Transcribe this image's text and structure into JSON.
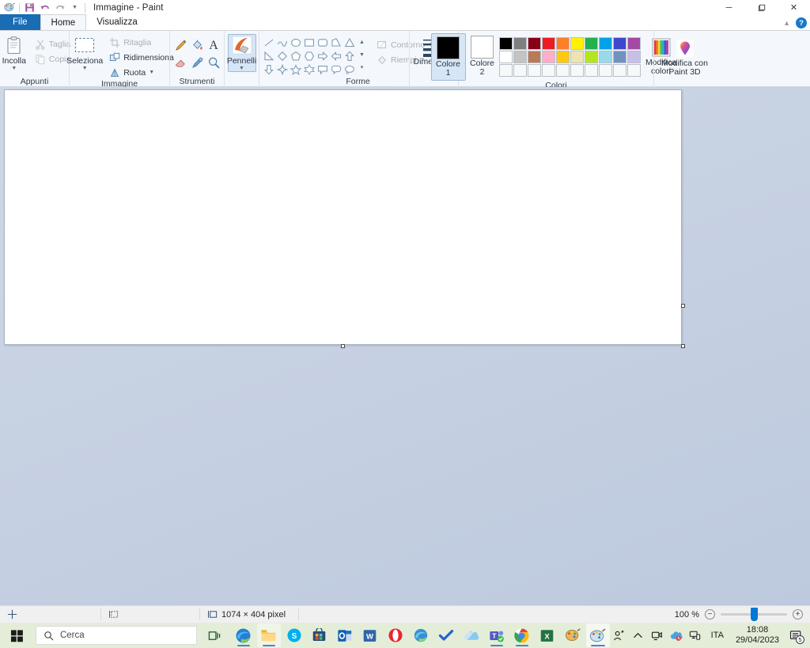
{
  "window": {
    "title": "Immagine - Paint",
    "quick_access": [
      "paint-app-icon",
      "save-icon",
      "undo-icon",
      "redo-icon",
      "customize-caret-icon"
    ],
    "controls": {
      "minimize": "─",
      "maximize": "❐",
      "close": "✕"
    }
  },
  "tabs": {
    "file": "File",
    "items": [
      {
        "label": "Home",
        "active": true
      },
      {
        "label": "Visualizza",
        "active": false
      }
    ],
    "collapse_icon": "chevron-up-icon",
    "help_icon": "help-icon",
    "help_glyph": "?"
  },
  "ribbon": {
    "groups": [
      {
        "name": "clipboard",
        "label": "Appunti",
        "big_button": {
          "label": "Incolla",
          "icon": "paste-icon",
          "has_caret": true
        },
        "small_buttons": [
          {
            "label": "Taglia",
            "icon": "scissors-icon",
            "disabled": true
          },
          {
            "label": "Copia",
            "icon": "copy-icon",
            "disabled": true
          }
        ]
      },
      {
        "name": "image",
        "label": "Immagine",
        "big_button": {
          "label": "Seleziona",
          "icon": "selection-rect-icon",
          "has_caret": true
        },
        "small_buttons": [
          {
            "label": "Ritaglia",
            "icon": "crop-icon",
            "disabled": true
          },
          {
            "label": "Ridimensiona",
            "icon": "resize-icon",
            "disabled": false
          },
          {
            "label": "Ruota",
            "icon": "rotate-icon",
            "disabled": false,
            "has_caret": true
          }
        ]
      },
      {
        "name": "tools",
        "label": "Strumenti",
        "tools": [
          {
            "name": "pencil-icon",
            "title": "Matita"
          },
          {
            "name": "fill-bucket-icon",
            "title": "Riempimento"
          },
          {
            "name": "text-icon",
            "title": "Testo"
          },
          {
            "name": "eraser-icon",
            "title": "Gomma"
          },
          {
            "name": "color-picker-icon",
            "title": "Selezione colore"
          },
          {
            "name": "magnifier-icon",
            "title": "Lente di ingrandimento"
          }
        ]
      },
      {
        "name": "brushes",
        "big_button": {
          "label": "Pennelli",
          "icon": "brush-icon",
          "has_caret": true,
          "selected": true
        }
      },
      {
        "name": "shapes",
        "label": "Forme",
        "shapes": [
          "line",
          "curve",
          "ellipse",
          "rectangle",
          "rounded-rectangle",
          "polygon",
          "triangle",
          "right-triangle",
          "diamond",
          "pentagon",
          "hexagon",
          "arrow-right",
          "arrow-left",
          "arrow-up",
          "arrow-down",
          "four-point-star",
          "five-point-star",
          "six-point-star",
          "callout-rect",
          "callout-round",
          "callout-cloud"
        ],
        "scroll": [
          "scroll-up-icon",
          "scroll-down-icon",
          "more-shapes-icon"
        ],
        "outline": {
          "label": "Contorno",
          "icon": "outline-icon",
          "disabled": true,
          "has_caret": true
        },
        "fill": {
          "label": "Riempi",
          "icon": "fill-icon",
          "disabled": true,
          "has_caret": true
        }
      },
      {
        "name": "size",
        "big_button": {
          "label": "Dimensioni",
          "icon": "line-size-icon",
          "has_caret": true
        }
      },
      {
        "name": "colors",
        "label": "Colori",
        "color1": {
          "label": "Colore 1",
          "value": "#000000",
          "selected": true
        },
        "color2": {
          "label": "Colore 2",
          "value": "#ffffff",
          "selected": false
        },
        "palette_rows": [
          [
            "#000000",
            "#7f7f7f",
            "#880015",
            "#ed1c24",
            "#ff7f27",
            "#fff200",
            "#22b14c",
            "#00a2e8",
            "#3f48cc",
            "#a349a4"
          ],
          [
            "#ffffff",
            "#c3c3c3",
            "#b97a57",
            "#ffaec9",
            "#ffc90e",
            "#efe4b0",
            "#b5e61d",
            "#99d9ea",
            "#7092be",
            "#c8bfe7"
          ],
          [
            "#f7f8fa",
            "#f7f8fa",
            "#f7f8fa",
            "#f7f8fa",
            "#f7f8fa",
            "#f7f8fa",
            "#f7f8fa",
            "#f7f8fa",
            "#f7f8fa",
            "#f7f8fa"
          ]
        ],
        "edit_colors": {
          "label_line1": "Modifica",
          "label_line2": "colori",
          "icon": "color-wheel-icon"
        }
      },
      {
        "name": "paint3d",
        "paint3d": {
          "label_line1": "Modifica con",
          "label_line2": "Paint 3D",
          "icon": "paint3d-icon"
        }
      }
    ]
  },
  "canvas": {
    "background": "#ffffff",
    "handles": [
      "right-middle-handle",
      "bottom-center-handle",
      "bottom-right-handle"
    ]
  },
  "statusbar": {
    "cursor_icon": "cursor-position-icon",
    "cursor_position": "",
    "selection_icon": "selection-size-icon",
    "selection_size": "",
    "image_icon": "image-size-icon",
    "image_size": "1074 × 404 pixel",
    "zoom_level": "100 %",
    "zoom_out": "−",
    "zoom_in": "+"
  },
  "taskbar": {
    "start": "windows-start-icon",
    "search": {
      "icon": "search-icon",
      "placeholder": "Cerca",
      "value": ""
    },
    "task_view": "task-view-icon",
    "apps": [
      {
        "name": "edge-icon",
        "title": "Microsoft Edge",
        "state": "open"
      },
      {
        "name": "file-explorer-icon",
        "title": "Esplora file",
        "state": "open"
      },
      {
        "name": "skype-icon",
        "title": "Skype",
        "state": "idle"
      },
      {
        "name": "microsoft-store-icon",
        "title": "Microsoft Store",
        "state": "idle"
      },
      {
        "name": "outlook-icon",
        "title": "Outlook",
        "state": "idle"
      },
      {
        "name": "word-icon",
        "title": "Word",
        "state": "idle"
      },
      {
        "name": "opera-icon",
        "title": "Opera",
        "state": "idle"
      },
      {
        "name": "edge-chromium-icon",
        "title": "Edge",
        "state": "idle"
      },
      {
        "name": "todo-icon",
        "title": "Microsoft To Do",
        "state": "idle"
      },
      {
        "name": "onedrive-icon",
        "title": "OneDrive",
        "state": "idle"
      },
      {
        "name": "teams-icon",
        "title": "Microsoft Teams",
        "state": "open"
      },
      {
        "name": "chrome-icon",
        "title": "Google Chrome",
        "state": "open"
      },
      {
        "name": "excel-icon",
        "title": "Excel",
        "state": "idle"
      },
      {
        "name": "paint-legacy-icon",
        "title": "Paint",
        "state": "idle"
      },
      {
        "name": "paint-icon",
        "title": "Immagine - Paint",
        "state": "active"
      }
    ],
    "tray": [
      {
        "name": "people-icon"
      },
      {
        "name": "show-hidden-icons-icon"
      },
      {
        "name": "meet-now-icon"
      },
      {
        "name": "onedrive-tray-icon"
      },
      {
        "name": "network-icon"
      }
    ],
    "language": "ITA",
    "clock": {
      "time": "18:08",
      "date": "29/04/2023"
    },
    "notifications": {
      "icon": "notifications-icon",
      "count": "5"
    }
  }
}
